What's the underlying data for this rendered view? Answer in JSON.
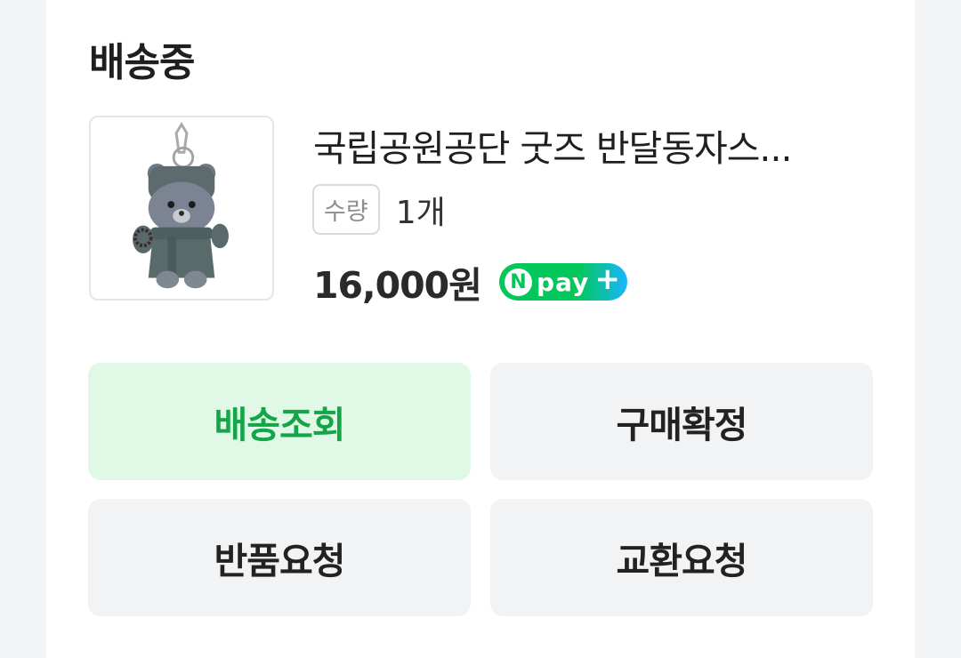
{
  "order": {
    "status": "배송중",
    "product_title": "국립공원공단 굿즈 반달동자스...",
    "quantity_label": "수량",
    "quantity_value": "1개",
    "price": "16,000원",
    "payment_badge": {
      "n": "N",
      "text": "pay",
      "plus": "+"
    },
    "product_image_icon": "bear-plush-keychain-image"
  },
  "actions": {
    "track": "배송조회",
    "confirm": "구매확정",
    "return": "반품요청",
    "exchange": "교환요청"
  },
  "colors": {
    "accent_green": "#13a548",
    "accent_bg": "#e0f8e6",
    "button_bg": "#f2f3f5",
    "npay_green": "#03c75a",
    "npay_blue": "#1ab5ff"
  }
}
